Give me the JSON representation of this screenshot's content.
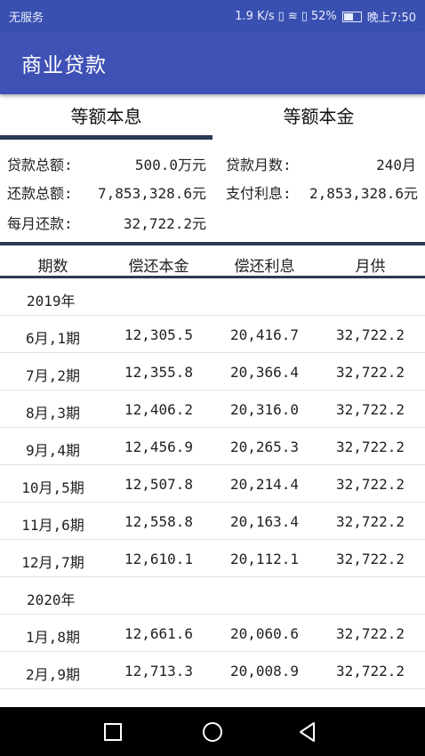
{
  "status_bar": {
    "carrier": "无服务",
    "speed": "1.9 K/s",
    "battery": "52%",
    "time": "晚上7:50"
  },
  "app_bar": {
    "title": "商业贷款"
  },
  "tabs": [
    {
      "label": "等额本息"
    },
    {
      "label": "等额本金"
    }
  ],
  "summary": {
    "loan_total_label": "贷款总额:",
    "loan_total_value": "500.0万元",
    "months_label": "贷款月数:",
    "months_value": "240月",
    "repay_total_label": "还款总额:",
    "repay_total_value": "7,853,328.6元",
    "interest_label": "支付利息:",
    "interest_value": "2,853,328.6元",
    "monthly_label": "每月还款:",
    "monthly_value": "32,722.2元"
  },
  "table": {
    "headers": [
      "期数",
      "偿还本金",
      "偿还利息",
      "月供"
    ],
    "rows": [
      {
        "year": "2019年"
      },
      {
        "cells": [
          "6月,1期",
          "12,305.5",
          "20,416.7",
          "32,722.2"
        ]
      },
      {
        "cells": [
          "7月,2期",
          "12,355.8",
          "20,366.4",
          "32,722.2"
        ]
      },
      {
        "cells": [
          "8月,3期",
          "12,406.2",
          "20,316.0",
          "32,722.2"
        ]
      },
      {
        "cells": [
          "9月,4期",
          "12,456.9",
          "20,265.3",
          "32,722.2"
        ]
      },
      {
        "cells": [
          "10月,5期",
          "12,507.8",
          "20,214.4",
          "32,722.2"
        ]
      },
      {
        "cells": [
          "11月,6期",
          "12,558.8",
          "20,163.4",
          "32,722.2"
        ]
      },
      {
        "cells": [
          "12月,7期",
          "12,610.1",
          "20,112.1",
          "32,722.2"
        ]
      },
      {
        "year": "2020年"
      },
      {
        "cells": [
          "1月,8期",
          "12,661.6",
          "20,060.6",
          "32,722.2"
        ]
      },
      {
        "cells": [
          "2月,9期",
          "12,713.3",
          "20,008.9",
          "32,722.2"
        ]
      }
    ]
  },
  "nav": {
    "icons": [
      "square-icon",
      "circle-icon",
      "triangle-back-icon"
    ]
  },
  "colors": {
    "app_bar": "#3f51b5",
    "status_bar": "#3a50b0",
    "indicator": "#2d3a55"
  }
}
